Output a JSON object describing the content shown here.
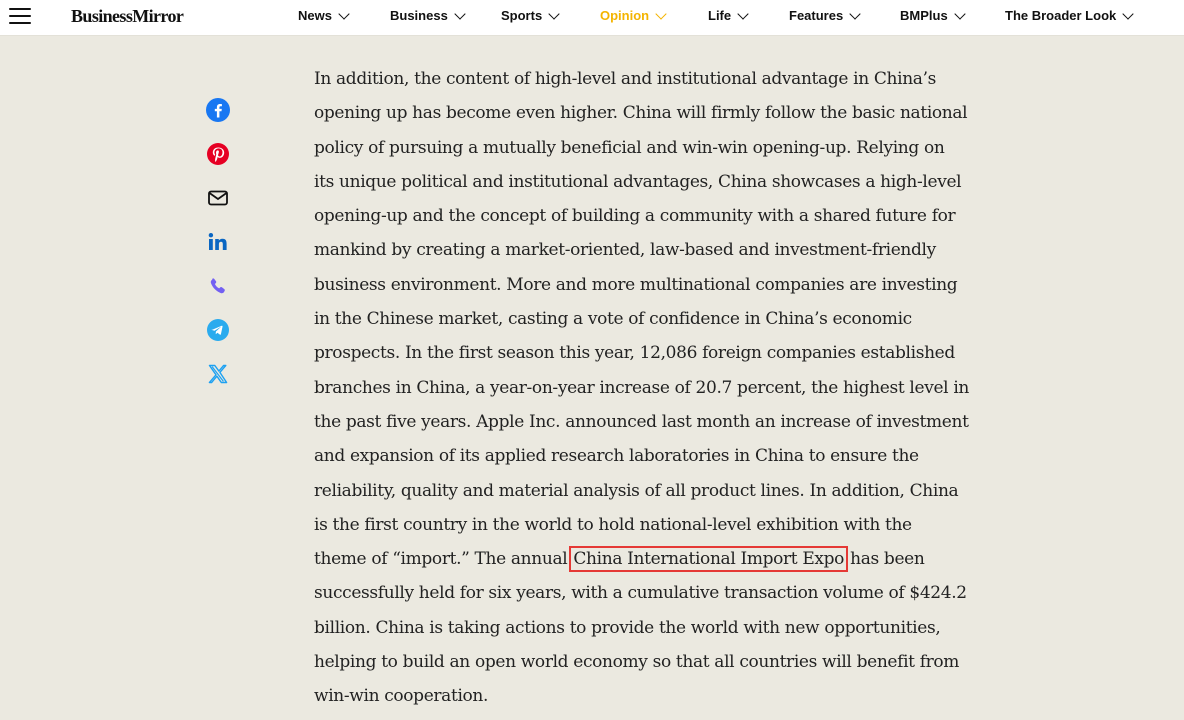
{
  "header": {
    "logo": "BusinessMirror",
    "nav": [
      {
        "label": "News",
        "active": false
      },
      {
        "label": "Business",
        "active": false
      },
      {
        "label": "Sports",
        "active": false
      },
      {
        "label": "Opinion",
        "active": true
      },
      {
        "label": "Life",
        "active": false
      },
      {
        "label": "Features",
        "active": false
      },
      {
        "label": "BMPlus",
        "active": false
      },
      {
        "label": "The Broader Look",
        "active": false
      }
    ],
    "active_color": "#f4b400"
  },
  "share": {
    "icons": [
      "facebook-icon",
      "pinterest-icon",
      "email-icon",
      "linkedin-icon",
      "viber-icon",
      "telegram-icon",
      "x-twitter-icon"
    ],
    "colors": {
      "facebook": "#1877f2",
      "pinterest": "#e60023",
      "linkedin": "#0a66c2",
      "viber": "#7360f2",
      "telegram": "#2aabee",
      "x": "#1da1f2"
    }
  },
  "article": {
    "lines": [
      "In addition, the content of high-level and institutional advantage in China’s",
      "opening up has become even higher. China will firmly follow the basic national",
      "policy of pursuing a mutually beneficial and win-win opening-up. Relying on",
      "its unique political and institutional advantages, China showcases a high-level",
      "opening-up and the concept of building a community with a shared future for",
      "mankind by creating a market-oriented, law-based and investment-friendly",
      "business environment. More and more multinational companies are investing",
      "in the Chinese market, casting a vote of confidence in China’s economic",
      "prospects. In the first season this year, 12,086 foreign companies established",
      "branches in China, a year-on-year increase of 20.7 percent, the highest level in",
      "the past five years. Apple Inc. announced last month an increase of investment",
      "and expansion of its applied research laboratories in China to ensure the",
      "reliability, quality and material analysis of all product lines. In addition, China",
      "is the first country in the world to hold national-level exhibition with the"
    ],
    "hl_line_before": "theme of “import.” The annual ",
    "hl_text": "China International Import Expo",
    "hl_line_after": " has been",
    "lines_after": [
      "successfully held for six years, with a cumulative transaction volume of $424.2",
      "billion. China is taking actions to provide the world with new opportunities,",
      "helping to build an open world economy so that all countries will benefit from",
      "win-win cooperation."
    ],
    "highlight_color": "#e53935"
  }
}
